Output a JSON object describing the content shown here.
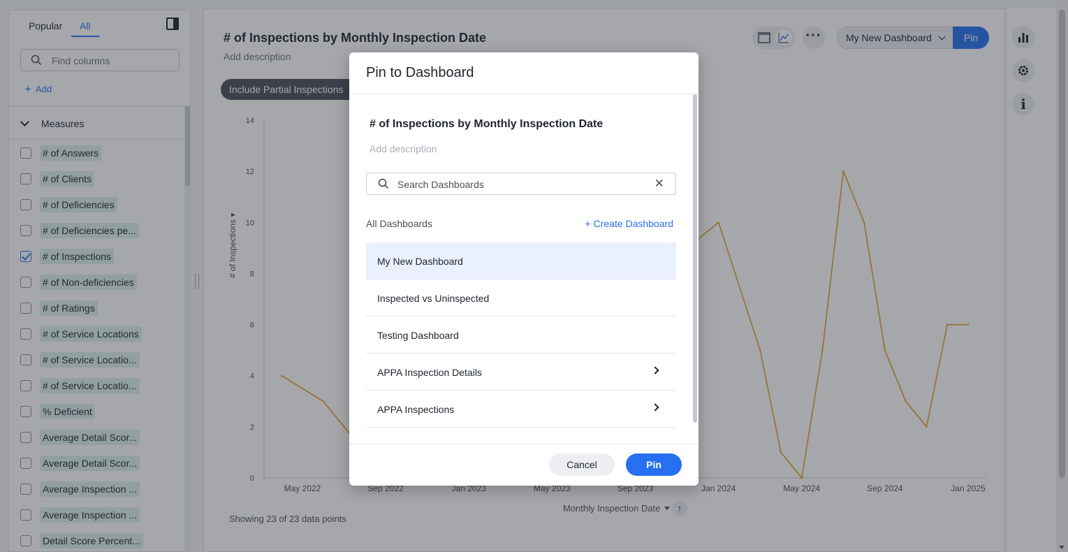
{
  "left_panel": {
    "tabs": [
      "Popular",
      "All"
    ],
    "active_tab": "All",
    "find_placeholder": "Find columns",
    "add_label": "Add",
    "section_label": "Measures",
    "columns": [
      {
        "label": "# of Answers",
        "checked": false
      },
      {
        "label": "# of Clients",
        "checked": false
      },
      {
        "label": "# of Deficiencies",
        "checked": false
      },
      {
        "label": "# of Deficiencies pe...",
        "checked": false
      },
      {
        "label": "# of Inspections",
        "checked": true
      },
      {
        "label": "# of Non-deficiencies",
        "checked": false
      },
      {
        "label": "# of Ratings",
        "checked": false
      },
      {
        "label": "# of Service Locations",
        "checked": false
      },
      {
        "label": "# of Service Locatio...",
        "checked": false
      },
      {
        "label": "# of Service Locatio...",
        "checked": false
      },
      {
        "label": "% Deficient",
        "checked": false
      },
      {
        "label": "Average Detail Scor...",
        "checked": false
      },
      {
        "label": "Average Detail Scor...",
        "checked": false
      },
      {
        "label": "Average Inspection ...",
        "checked": false
      },
      {
        "label": "Average Inspection ...",
        "checked": false
      },
      {
        "label": "Detail Score Percent...",
        "checked": false
      }
    ]
  },
  "main": {
    "title": "# of Inspections by Monthly Inspection Date",
    "description": "Add description",
    "filter_chip": "Include Partial Inspections",
    "more_label": "···",
    "dashboard_select": "My New Dashboard",
    "pin_label": "Pin",
    "showing_text": "Showing 23 of 23 data points",
    "sort_glyph": "↑"
  },
  "chart_data": {
    "type": "line",
    "xlabel": "Monthly Inspection Date",
    "ylabel": "# of Inspections",
    "ylim": [
      0,
      14
    ],
    "y_ticks": [
      "0",
      "2",
      "4",
      "6",
      "8",
      "10",
      "12",
      "14"
    ],
    "x_tick_labels": [
      "May 2022",
      "Sep 2022",
      "Jan 2023",
      "May 2023",
      "Sep 2023",
      "Jan 2024",
      "May 2024",
      "Sep 2024",
      "Jan 2025"
    ],
    "series": [
      {
        "color": "#e0a020",
        "x": [
          "2022-04",
          "2022-06",
          "2022-07",
          "2022-08",
          "2023-10",
          "2024-01",
          "2024-03",
          "2024-04",
          "2024-05",
          "2024-06",
          "2024-07",
          "2024-08",
          "2024-09",
          "2024-10",
          "2024-11",
          "2024-12",
          "2025-01"
        ],
        "values": [
          4,
          3,
          2,
          1,
          8,
          10,
          5,
          1,
          0,
          5,
          12,
          10,
          5,
          3,
          2,
          6,
          6
        ]
      }
    ]
  },
  "modal": {
    "title": "Pin to Dashboard",
    "viz_name": "# of Inspections by Monthly Inspection Date",
    "viz_description_placeholder": "Add description",
    "search_placeholder": "Search Dashboards",
    "list_header": "All Dashboards",
    "create_label": "+ Create Dashboard",
    "dashboards": [
      {
        "label": "My New Dashboard",
        "selected": true,
        "has_children": false
      },
      {
        "label": "Inspected vs Uninspected",
        "selected": false,
        "has_children": false
      },
      {
        "label": "Testing Dashboard",
        "selected": false,
        "has_children": false
      },
      {
        "label": "APPA Inspection Details",
        "selected": false,
        "has_children": true
      },
      {
        "label": "APPA Inspections",
        "selected": false,
        "has_children": true
      }
    ],
    "cancel_label": "Cancel",
    "pin_label": "Pin"
  },
  "colors": {
    "accent": "#2770ef",
    "line": "#e0a020",
    "chip_green": "#dff2ea"
  },
  "icons": {
    "collapse": "sidebar-collapse-icon",
    "search": "search-icon",
    "chart": "bar-chart-icon",
    "settings": "gear-icon",
    "info": "info-icon"
  }
}
